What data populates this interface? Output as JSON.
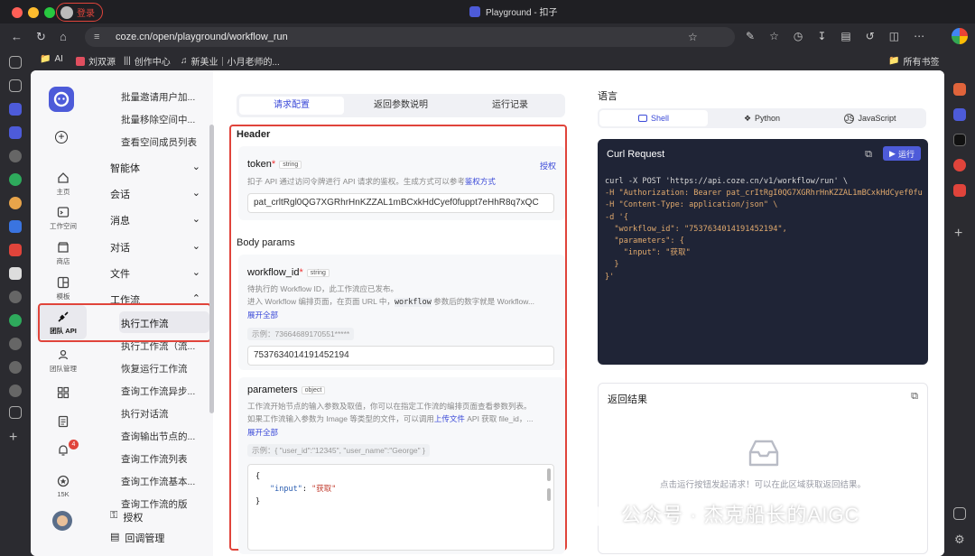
{
  "browser": {
    "login_label": "登录",
    "window_title": "Playground - 扣子",
    "url": "coze.cn/open/playground/workflow_run",
    "bookmarks": [
      "AI",
      "刘双源",
      "创作中心",
      "新美业｜小月老师的...",
      "所有书签"
    ]
  },
  "lnav": {
    "items": [
      "主页",
      "工作空间",
      "商店",
      "模板",
      "团队 API",
      "团队管理",
      "15K"
    ],
    "badge": "4"
  },
  "tree": {
    "top_items": [
      "批量邀请用户加...",
      "批量移除空间中...",
      "查看空间成员列表"
    ],
    "groups": [
      "智能体",
      "会话",
      "消息",
      "对话",
      "文件",
      "工作流"
    ],
    "workflow_items": [
      "执行工作流",
      "执行工作流（流...",
      "恢复运行工作流",
      "查询工作流异步...",
      "执行对话流",
      "查询输出节点的...",
      "查询工作流列表",
      "查询工作流基本...",
      "查询工作流的版"
    ],
    "bottom_items": [
      "授权",
      "回调管理"
    ]
  },
  "mid": {
    "tabs": [
      "请求配置",
      "返回参数说明",
      "运行记录"
    ],
    "header_title": "Header",
    "token": {
      "label": "token",
      "type": "string",
      "auth_link": "授权",
      "desc_prefix": "扣子 API 通过访问令牌进行 API 请求的鉴权。生成方式可以参考",
      "desc_link": "鉴权方式",
      "value": "pat_crltRgl0QG7XGRhrHnKZZAL1mBCxkHdCyef0fuppt7eHhR8q7xQC"
    },
    "body_title": "Body params",
    "workflow_id": {
      "label": "workflow_id",
      "type": "string",
      "desc1": "待执行的 Workflow ID，此工作流应已发布。",
      "desc2_prefix": "进入 Workflow 编排页面，在页面 URL 中，",
      "desc2_code": "workflow",
      "desc2_suffix": " 参数后的数字就是 Workflow...",
      "expand": "展开全部",
      "example": "示例：73664689170551*****",
      "value": "7537634014191452194"
    },
    "parameters": {
      "label": "parameters",
      "type": "object",
      "desc1": "工作流开始节点的输入参数及取值，你可以在指定工作流的编排页面查看参数列表。",
      "desc2_prefix": "如果工作流输入参数为 Image 等类型的文件，可以调用",
      "desc2_link": "上传文件",
      "desc2_suffix": " API 获取 file_id，...",
      "expand": "展开全部",
      "example": "示例：{ \"user_id\":\"12345\", \"user_name\":\"George\" }",
      "code_open": "{",
      "code_key": "\"input\"",
      "code_colon": ": ",
      "code_val": "\"获取\"",
      "code_close": "}"
    }
  },
  "right": {
    "lang_title": "语言",
    "lang_tabs": [
      "Shell",
      "Python",
      "JavaScript"
    ],
    "curl_title": "Curl Request",
    "run_label": "运行",
    "code_lines": [
      "curl -X POST 'https://api.coze.cn/v1/workflow/run' \\",
      "-H \"Authorization: Bearer pat_crItRgI0QG7XGRhrHnKZZAL1mBCxkHdCyef0fu",
      "-H \"Content-Type: application/json\" \\",
      "-d '{",
      "  \"workflow_id\": \"7537634014191452194\",",
      "  \"parameters\": {",
      "    \"input\": \"获取\"",
      "  }",
      "}'"
    ],
    "result_title": "返回结果",
    "result_hint": "点击运行按钮发起请求！可以在此区域获取返回结果。"
  },
  "watermark": "公众号 · 杰克船长的AIGC"
}
